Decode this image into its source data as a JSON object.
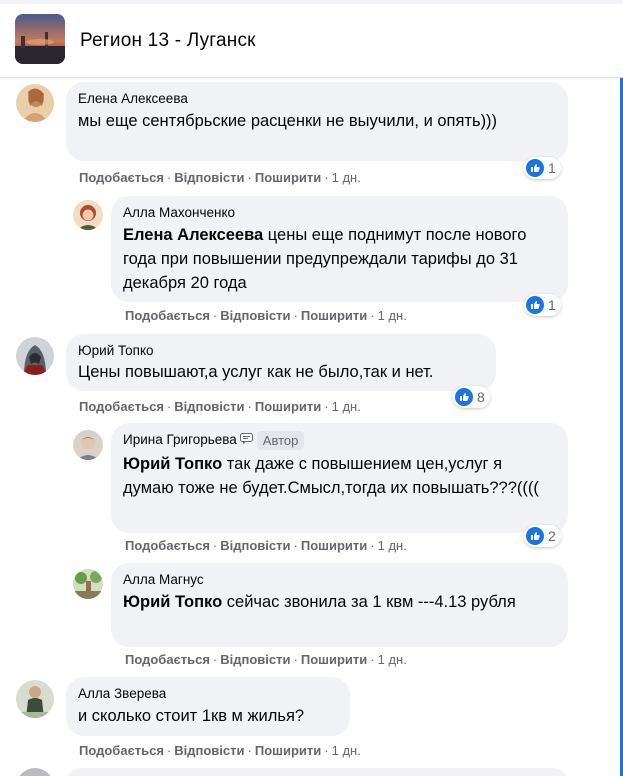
{
  "group": {
    "title": "Регион 13 - Луганск",
    "accent": "#1b74e4"
  },
  "actions": {
    "like": "Подобається",
    "reply": "Відповісти",
    "share": "Поширити",
    "dot": "·"
  },
  "comments": [
    {
      "author": "Елена Алексеева",
      "mention": "",
      "text": "мы еще сентябрьские расценки не выучили, и опять)))",
      "time": "1 дн.",
      "likes": "1"
    },
    {
      "author": "Алла Махонченко",
      "mention": "Елена Алексеева",
      "text": "цены еще поднимут после нового года при повышении предупреждали тарифы до 31 декабря 20 года",
      "time": "1 дн.",
      "likes": "1"
    },
    {
      "author": "Юрий Топко",
      "mention": "",
      "text": "Цены повышают,а услуг как не было,так и нет.",
      "time": "1 дн.",
      "likes": "8"
    },
    {
      "author": "Ирина Григорьева",
      "badge": "Автор",
      "mention": "Юрий Топко",
      "text": "так даже с повышением цен,услуг я думаю тоже не будет.Смысл,тогда их повышать???((((",
      "time": "1 дн.",
      "likes": "2"
    },
    {
      "author": "Алла Магнус",
      "mention": "Юрий Топко",
      "text": "сейчас звонила за 1 квм ---4.13 рубля",
      "time": "1 дн."
    },
    {
      "author": "Алла Зверева",
      "mention": "",
      "text": "и сколько стоит 1кв м жилья?",
      "time": "1 дн."
    }
  ]
}
